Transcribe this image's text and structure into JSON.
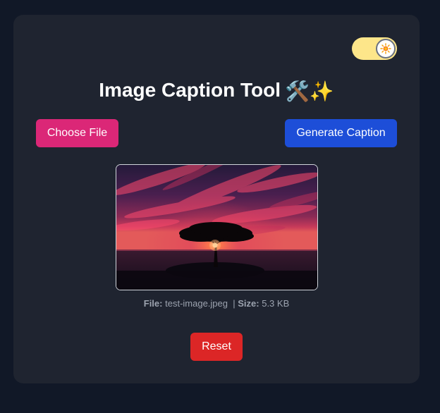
{
  "app": {
    "title": "Image Caption Tool",
    "title_emoji": "🛠️✨"
  },
  "theme_toggle": {
    "state": "light",
    "icon": "sun-icon"
  },
  "buttons": {
    "choose_file": "Choose File",
    "generate_caption": "Generate Caption",
    "reset": "Reset"
  },
  "preview": {
    "image_description_icon": "image-preview"
  },
  "file_info": {
    "file_label": "File:",
    "file_name": "test-image.jpeg",
    "separator": "|",
    "size_label": "Size:",
    "size_value": "5.3 KB"
  },
  "colors": {
    "background": "#111827",
    "card": "#1f2430",
    "choose_button": "#db2777",
    "generate_button": "#1d4ed8",
    "reset_button": "#dc2626",
    "toggle_track": "#fde68a"
  }
}
